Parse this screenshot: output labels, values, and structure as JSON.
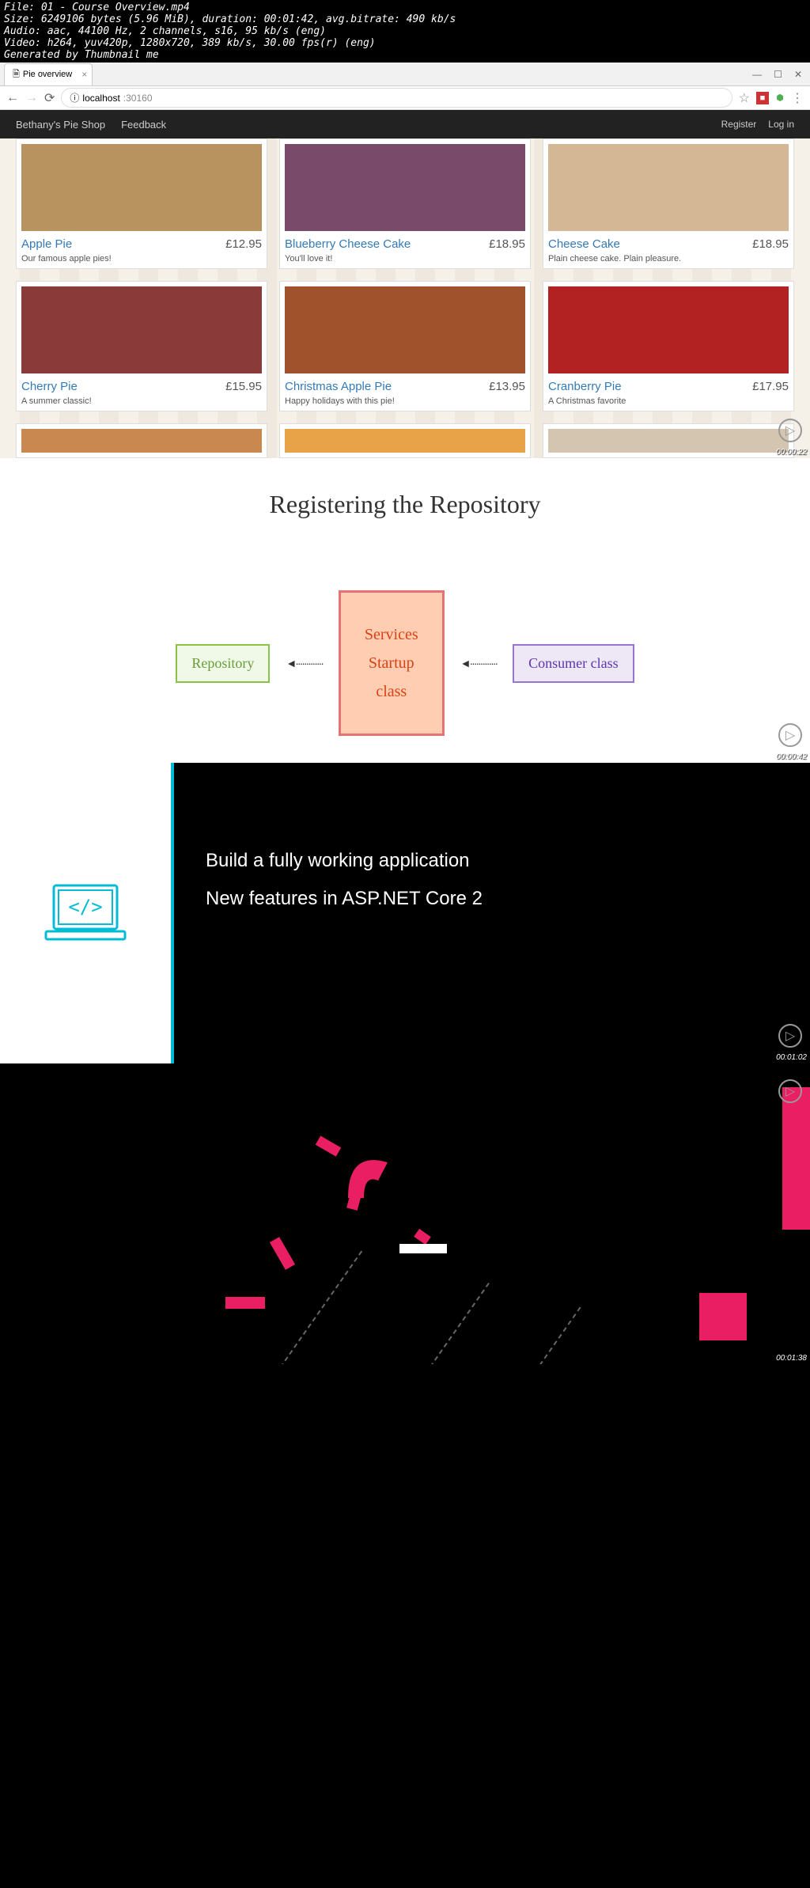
{
  "video_info": {
    "file": "File: 01 - Course Overview.mp4",
    "size": "Size: 6249106 bytes (5.96 MiB), duration: 00:01:42, avg.bitrate: 490 kb/s",
    "audio": "Audio: aac, 44100 Hz, 2 channels, s16, 95 kb/s (eng)",
    "video": "Video: h264, yuv420p, 1280x720, 389 kb/s, 30.00 fps(r) (eng)",
    "generated": "Generated by Thumbnail me"
  },
  "browser": {
    "tab_title": "Pie overview",
    "url_host": "localhost",
    "url_port": ":30160",
    "info_icon": "ⓘ"
  },
  "nav": {
    "brand": "Bethany's Pie Shop",
    "feedback": "Feedback",
    "register": "Register",
    "login": "Log in"
  },
  "pies": [
    {
      "name": "Apple Pie",
      "price": "£12.95",
      "desc": "Our famous apple pies!",
      "color": "#b8935f"
    },
    {
      "name": "Blueberry Cheese Cake",
      "price": "£18.95",
      "desc": "You'll love it!",
      "color": "#7a4a6a"
    },
    {
      "name": "Cheese Cake",
      "price": "£18.95",
      "desc": "Plain cheese cake. Plain pleasure.",
      "color": "#d4b896"
    },
    {
      "name": "Cherry Pie",
      "price": "£15.95",
      "desc": "A summer classic!",
      "color": "#8b3a3a"
    },
    {
      "name": "Christmas Apple Pie",
      "price": "£13.95",
      "desc": "Happy holidays with this pie!",
      "color": "#a0522d"
    },
    {
      "name": "Cranberry Pie",
      "price": "£17.95",
      "desc": "A Christmas favorite",
      "color": "#b22222"
    }
  ],
  "slide2": {
    "title": "Registering the Repository",
    "box1": "Repository",
    "box2_line1": "Services",
    "box2_line2": "Startup",
    "box2_line3": "class",
    "box3": "Consumer class"
  },
  "slide3": {
    "line1": "Build a fully working application",
    "line2": "New features in ASP.NET Core 2"
  },
  "timestamps": {
    "t1": "00:00:22",
    "t2": "00:00:42",
    "t3": "00:01:02",
    "t4": "00:01:38"
  }
}
